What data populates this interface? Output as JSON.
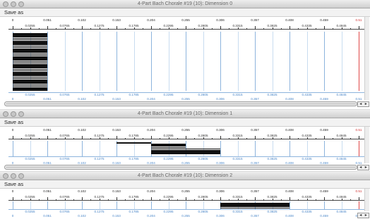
{
  "windows": [
    {
      "title": "4-Part Bach Chorale #19 (10): Dimension 0",
      "save_label": "Save as",
      "bars": [
        [
          0,
          0.051
        ],
        [
          0,
          0.051
        ],
        [
          0,
          0.051
        ],
        [
          0,
          0.051
        ],
        [
          0,
          0.051
        ],
        [
          0,
          0.051
        ],
        [
          0,
          0.051
        ],
        [
          0,
          0.051
        ],
        [
          0,
          0.051
        ],
        [
          0,
          0.051
        ],
        [
          0,
          0.051
        ],
        [
          0,
          0.051
        ],
        [
          0,
          0.051
        ],
        [
          0,
          0.051
        ],
        [
          0,
          0.051
        ],
        [
          0,
          0.051
        ],
        [
          0,
          0.051
        ],
        [
          0,
          0.051
        ],
        [
          0,
          0.051
        ],
        [
          0,
          0.051
        ],
        [
          0,
          0.051
        ],
        [
          0,
          0.051
        ],
        [
          0,
          0.051
        ],
        [
          0,
          0.051
        ],
        [
          0,
          0.051
        ],
        [
          0,
          0.051
        ],
        [
          0,
          0.051
        ],
        [
          0,
          0.051
        ],
        [
          0,
          0.051
        ],
        [
          0,
          0.051
        ],
        [
          0,
          0.051
        ],
        [
          0,
          0.051
        ],
        [
          0,
          0.051
        ],
        [
          0,
          0.051
        ],
        [
          0,
          0.051
        ],
        [
          0,
          0.051
        ],
        [
          0,
          0.051
        ],
        [
          0,
          0.051
        ],
        [
          0,
          0.051
        ],
        [
          0,
          0.051
        ],
        [
          0,
          0.102
        ],
        [
          0,
          0.102
        ],
        [
          0,
          0.102
        ],
        [
          0,
          0.102
        ],
        [
          0,
          0.102
        ],
        [
          0,
          0.102
        ],
        [
          0,
          0.102
        ],
        [
          0,
          0.102
        ],
        [
          0,
          0.102
        ],
        [
          0,
          0.102
        ],
        [
          0,
          0.102
        ],
        [
          0,
          0.102
        ],
        [
          0,
          0.102
        ],
        [
          0,
          0.102
        ],
        [
          0,
          0.153
        ],
        [
          0,
          0.153
        ],
        [
          0,
          0.153
        ],
        [
          0,
          0.153
        ],
        [
          0,
          0.51
        ]
      ]
    },
    {
      "title": "4-Part Bach Chorale #19 (10): Dimension 1",
      "save_label": "Save as",
      "bars": [
        [
          0.153,
          0.204
        ],
        [
          0.204,
          0.255
        ],
        [
          0.204,
          0.255
        ],
        [
          0.204,
          0.255
        ],
        [
          0.204,
          0.306
        ],
        [
          0.204,
          0.306
        ],
        [
          0.204,
          0.306
        ],
        [
          0.204,
          0.306
        ]
      ]
    },
    {
      "title": "4-Part Bach Chorale #19 (10): Dimension 2",
      "save_label": "Save as",
      "bars": [
        [
          0.306,
          0.408
        ],
        [
          0.306,
          0.408
        ],
        [
          0.306,
          0.408
        ],
        [
          0.306,
          0.408
        ]
      ]
    }
  ],
  "axis": {
    "major_ticks": [
      "0",
      "0.051",
      "0.102",
      "0.153",
      "0.204",
      "0.255",
      "0.306",
      "0.357",
      "0.408",
      "0.459",
      "0.51"
    ],
    "minor_ticks": [
      "0.0255",
      "0.0765",
      "0.1275",
      "0.1785",
      "0.2295",
      "0.2805",
      "0.3315",
      "0.3825",
      "0.4335",
      "0.4845"
    ],
    "max": 0.51
  },
  "scroll": {
    "left_arrow": "◂",
    "right_arrow": "▸"
  },
  "colors": {
    "grid": "#c8dcf0",
    "grid_major": "#8db4dd",
    "end_marker": "#e04848",
    "bar": "#111111",
    "bottom_labels": "#4a86c8"
  }
}
